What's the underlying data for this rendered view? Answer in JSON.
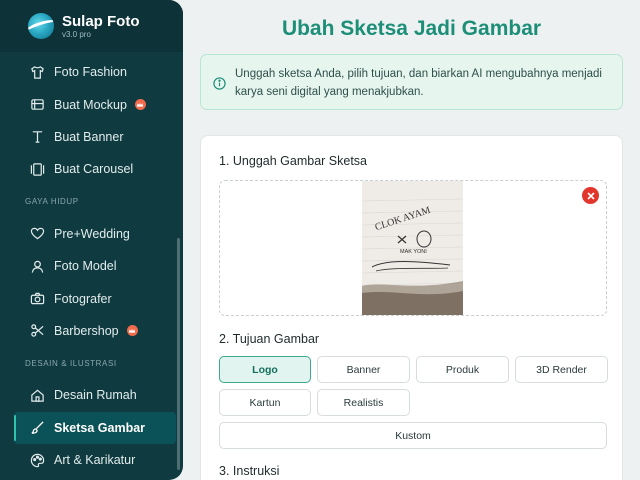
{
  "app": {
    "name": "Sulap Foto",
    "version": "v3.0 pro"
  },
  "sidebar": {
    "items": [
      {
        "label": "Foto Fashion",
        "icon": "shirt-icon"
      },
      {
        "label": "Buat Mockup",
        "icon": "mockup-icon",
        "premium": true
      },
      {
        "label": "Buat Banner",
        "icon": "text-icon"
      },
      {
        "label": "Buat Carousel",
        "icon": "carousel-icon"
      }
    ],
    "section_lifestyle": "GAYA HIDUP",
    "lifestyle": [
      {
        "label": "Pre+Wedding",
        "icon": "heart-icon"
      },
      {
        "label": "Foto Model",
        "icon": "user-icon"
      },
      {
        "label": "Fotografer",
        "icon": "camera-icon"
      },
      {
        "label": "Barbershop",
        "icon": "scissors-icon",
        "premium": true
      }
    ],
    "section_design": "DESAIN & ILUSTRASI",
    "design": [
      {
        "label": "Desain Rumah",
        "icon": "home-icon"
      },
      {
        "label": "Sketsa Gambar",
        "icon": "brush-icon",
        "active": true
      },
      {
        "label": "Art & Karikatur",
        "icon": "palette-icon"
      }
    ]
  },
  "main": {
    "title": "Ubah Sketsa Jadi Gambar",
    "info": "Unggah sketsa Anda, pilih tujuan, dan biarkan AI mengubahnya menjadi karya seni digital yang menakjubkan.",
    "step1": "1. Unggah Gambar Sketsa",
    "step2": "2. Tujuan Gambar",
    "step3": "3. Instruksi",
    "sketch_text": {
      "line1": "CLOK AYAM",
      "line2": "MAK YONI"
    },
    "purposes": [
      "Logo",
      "Banner",
      "Produk",
      "3D Render",
      "Kartun",
      "Realistis"
    ],
    "custom_label": "Kustom",
    "selected_purpose": "Logo"
  },
  "colors": {
    "sidebar": "#0f3a40",
    "accent": "#1d8f78",
    "danger": "#e2362c",
    "premium": "#f06a4b"
  }
}
